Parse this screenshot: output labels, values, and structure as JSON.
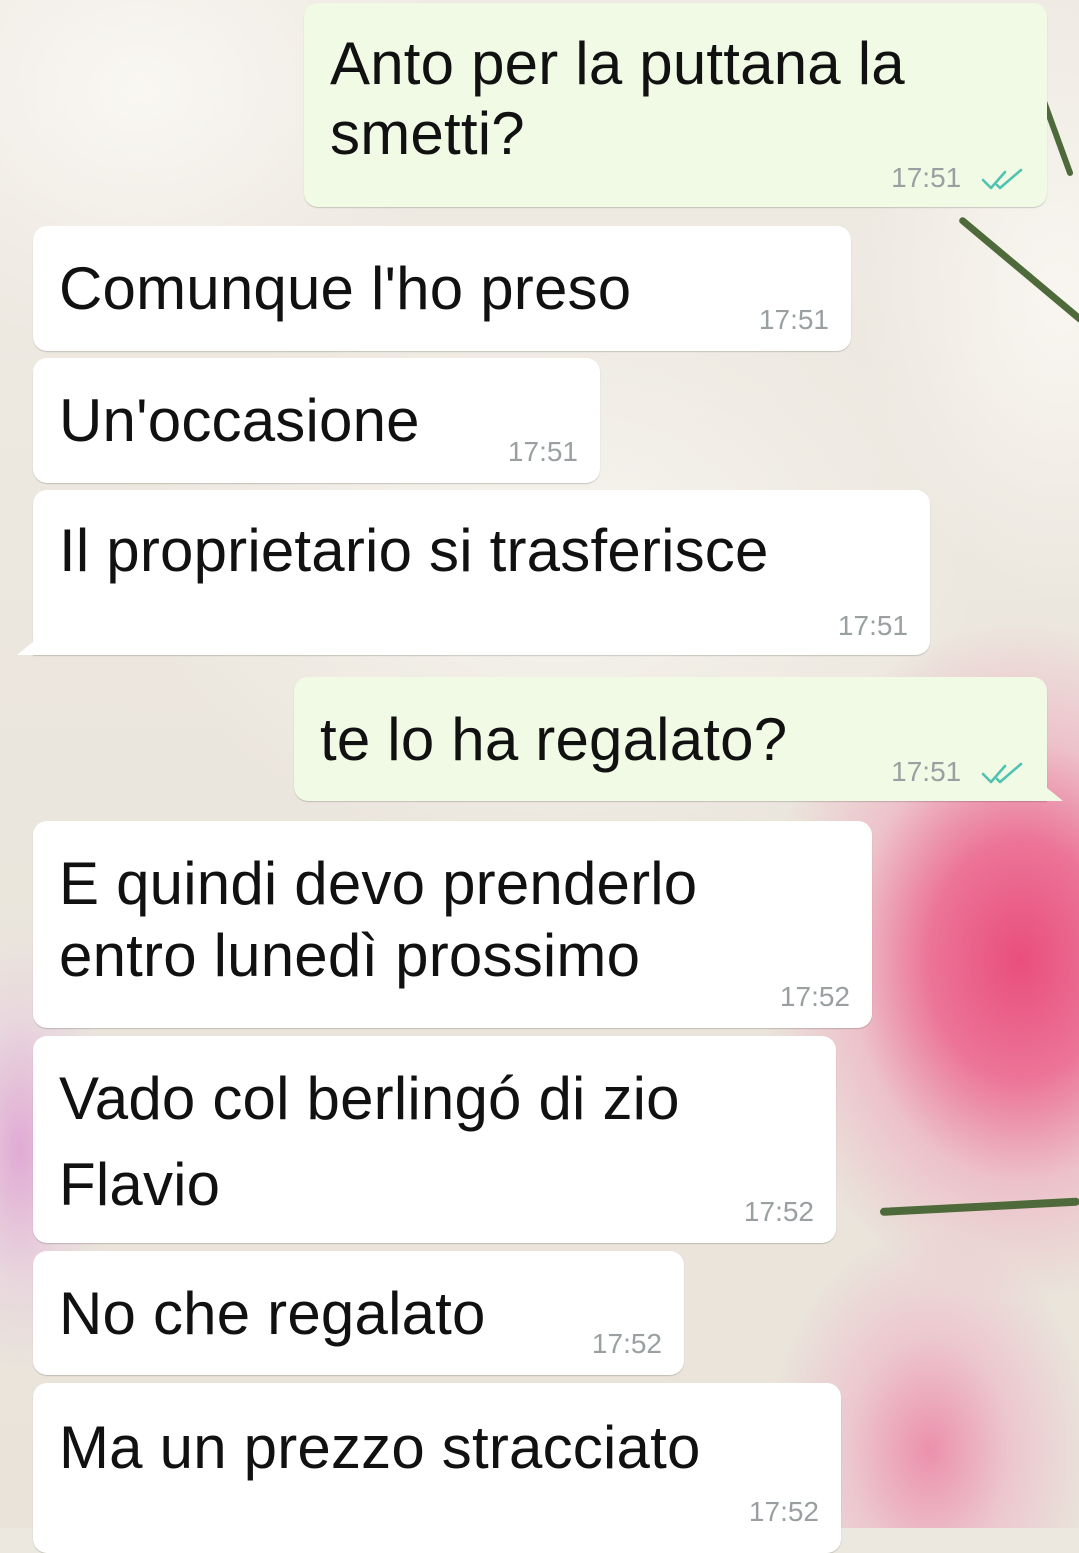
{
  "messages": [
    {
      "direction": "outgoing",
      "lines": [
        "Anto per la puttana la",
        "smetti?"
      ],
      "time": "17:51",
      "status": "read"
    },
    {
      "direction": "incoming",
      "lines": [
        "Comunque l'ho preso"
      ],
      "time": "17:51"
    },
    {
      "direction": "incoming",
      "lines": [
        "Un'occasione"
      ],
      "time": "17:51"
    },
    {
      "direction": "incoming",
      "lines": [
        "Il proprietario si trasferisce"
      ],
      "time": "17:51"
    },
    {
      "direction": "outgoing",
      "lines": [
        "te lo ha regalato?"
      ],
      "time": "17:51",
      "status": "read"
    },
    {
      "direction": "incoming",
      "lines": [
        "E quindi devo prenderlo",
        "entro lunedì prossimo"
      ],
      "time": "17:52"
    },
    {
      "direction": "incoming",
      "lines": [
        "Vado col berlingó di zio",
        "Flavio"
      ],
      "time": "17:52"
    },
    {
      "direction": "incoming",
      "lines": [
        "No che regalato"
      ],
      "time": "17:52"
    },
    {
      "direction": "incoming",
      "lines": [
        "Ma un prezzo stracciato"
      ],
      "time": "17:52"
    }
  ],
  "colors": {
    "incoming_bubble": "#ffffff",
    "outgoing_bubble": "#f0fae4",
    "timestamp": "#9aa0a2",
    "read_ticks": "#4fc3b0"
  },
  "icons": {
    "read_status": "double-check-icon"
  }
}
